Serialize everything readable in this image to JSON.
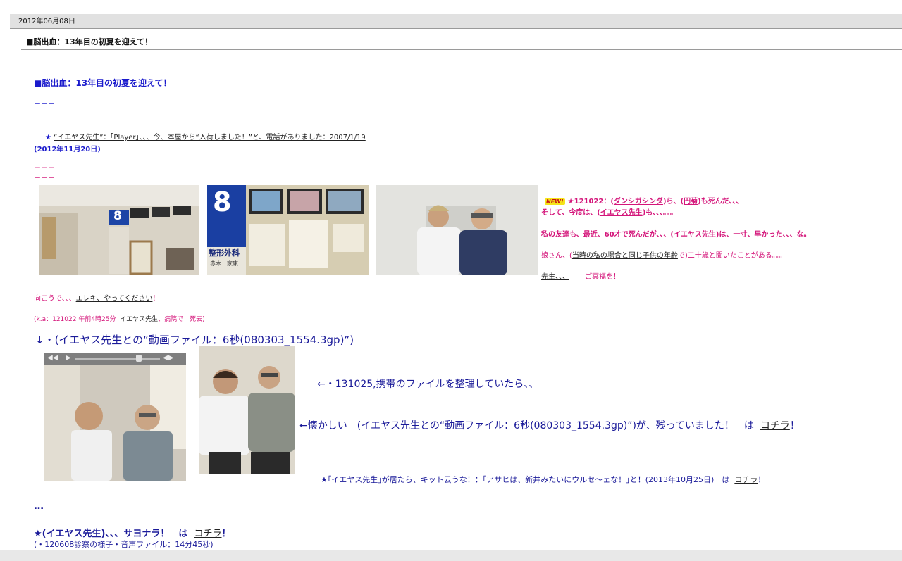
{
  "date_header": "2012年06月08日",
  "entry_title": "■脳出血：13年目の初夏を迎えて！",
  "body": {
    "heading": "■脳出血：13年目の初夏を迎えて！",
    "sep1": "－－－",
    "star_mark": "★",
    "line1": "“イエヤス先生”：｢Player｣、、、今、本屋から“入荷しました！”と、電話がありました：2007/1/19",
    "line1_date": "(2012年11月20日)",
    "sep2": "－－－",
    "sep3": "－－－",
    "news": {
      "badge": "NEW!",
      "l1_a": "★121022：(",
      "l1_link1": "ダンシガシンダ",
      "l1_b": ")ら、(",
      "l1_link2": "円菊",
      "l1_c": ")も死んだ、、、",
      "l2_a": "そして、今度は、(",
      "l2_link": "イエヤス先生",
      "l2_b": ")も、、、。。。",
      "l3": "私の友達も、最近、60才で死んだが、、、(イエヤス先生)は、一寸、早かった、、、な。",
      "l4_a": "娘さん、(",
      "l4_link": "当時の私の場合と同じ子供の年齢",
      "l4_b": "で)二十歳と聞いたことがある。。。",
      "l5_link": "先生、、、",
      "l5_b": "ご冥福を！"
    },
    "line_elec_a": "向こうで、、、",
    "line_elec_link": "エレキ、やってください",
    "line_elec_b": "！",
    "line_ka_a": "(k.a：121022 午前4時25分",
    "line_ka_link": "イエヤス先生",
    "line_ka_b": "、病院で　死去)",
    "video_line": "↓・(イエヤス先生との“動画ファイル：6秒(080303_1554.3gp)”)",
    "note1": "←・131025,携帯のファイルを整理していたら、、",
    "note2_a": "←懐かしい　(イエヤス先生との“動画ファイル：6秒(080303_1554.3gp)”)が、残っていました！　は",
    "note2_link": "コチラ",
    "note2_b": "！",
    "note3_a": "★｢イエヤス先生｣が居たら、キット云うな！：｢アサヒは、新井みたいにウルセ～ェな！｣と！(2013年10月25日)　は",
    "note3_link": "コチラ",
    "note3_b": "！",
    "dots": "…",
    "sayonara_a": "★(イエヤス先生)、、、サヨナラ！　は",
    "sayonara_link": "コチラ",
    "sayonara_b": "！",
    "last_line": "(・120608診察の様子・音声ファイル：14分45秒)"
  },
  "photos": {
    "p1_sign": "8",
    "p2_sign": "8",
    "p2_dept": "整形外科",
    "p2_name": "赤木　家康"
  },
  "colors": {
    "blue_text": "#1a1acc",
    "navy_text": "#1a1a99",
    "magenta_text": "#d4157a",
    "bar_gray": "#e1e1e1"
  }
}
